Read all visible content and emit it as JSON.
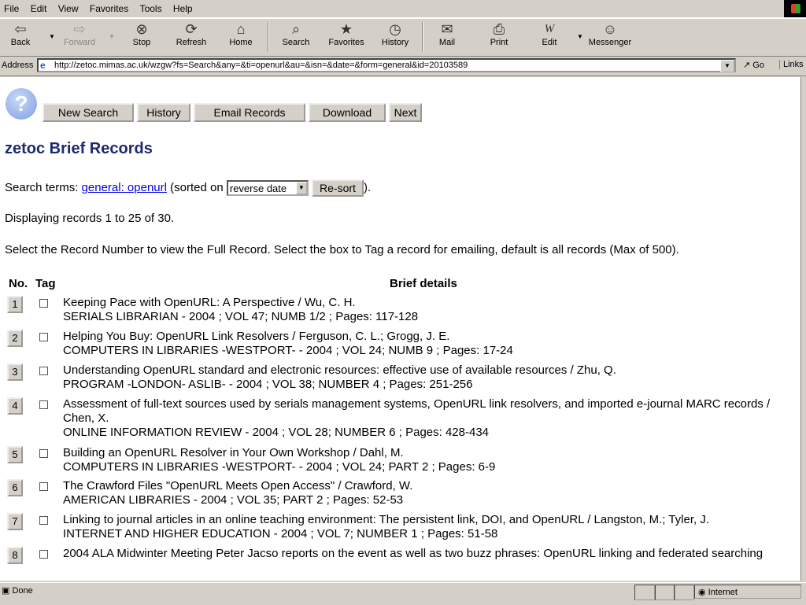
{
  "menu": [
    "File",
    "Edit",
    "View",
    "Favorites",
    "Tools",
    "Help"
  ],
  "toolbar": {
    "back": "Back",
    "forward": "Forward",
    "stop": "Stop",
    "refresh": "Refresh",
    "home": "Home",
    "search": "Search",
    "favorites": "Favorites",
    "history": "History",
    "mail": "Mail",
    "print": "Print",
    "edit": "Edit",
    "messenger": "Messenger"
  },
  "address": {
    "label": "Address",
    "url": "http://zetoc.mimas.ac.uk/wzgw?fs=Search&any=&ti=openurl&au=&isn=&date=&form=general&id=20103589",
    "go": "Go",
    "links": "Links"
  },
  "nav_buttons": [
    "New Search",
    "History",
    "Email Records",
    "Download",
    "Next"
  ],
  "page_title": "zetoc Brief Records",
  "search": {
    "prefix": "Search terms:",
    "link": "general: openurl",
    "sorted_on": "(sorted on",
    "sort_value": "reverse date",
    "resort": "Re-sort",
    "suffix": ")."
  },
  "displaying": "Displaying records 1 to 25 of 30.",
  "instructions": "Select the Record Number to view the Full Record. Select the box to Tag a record for emailing, default is all records (Max of 500).",
  "table_headers": {
    "no": "No.",
    "tag": "Tag",
    "details": "Brief details"
  },
  "records": [
    {
      "no": "1",
      "title": "Keeping Pace with OpenURL: A Perspective / Wu, C. H.",
      "source": "SERIALS LIBRARIAN - 2004 ; VOL 47; NUMB 1/2 ; Pages: 117-128"
    },
    {
      "no": "2",
      "title": "Helping You Buy: OpenURL Link Resolvers / Ferguson, C. L.; Grogg, J. E.",
      "source": "COMPUTERS IN LIBRARIES -WESTPORT- - 2004 ; VOL 24; NUMB 9 ; Pages: 17-24"
    },
    {
      "no": "3",
      "title": "Understanding OpenURL standard and electronic resources: effective use of available resources / Zhu, Q.",
      "source": "PROGRAM -LONDON- ASLIB- - 2004 ; VOL 38; NUMBER 4 ; Pages: 251-256"
    },
    {
      "no": "4",
      "title": "Assessment of full-text sources used by serials management systems, OpenURL link resolvers, and imported e-journal MARC records / Chen, X.",
      "source": "ONLINE INFORMATION REVIEW - 2004 ; VOL 28; NUMBER 6 ; Pages: 428-434"
    },
    {
      "no": "5",
      "title": "Building an OpenURL Resolver in Your Own Workshop / Dahl, M.",
      "source": "COMPUTERS IN LIBRARIES -WESTPORT- - 2004 ; VOL 24; PART 2 ; Pages: 6-9"
    },
    {
      "no": "6",
      "title": "The Crawford Files \"OpenURL Meets Open Access\" / Crawford, W.",
      "source": "AMERICAN LIBRARIES - 2004 ; VOL 35; PART 2 ; Pages: 52-53"
    },
    {
      "no": "7",
      "title": "Linking to journal articles in an online teaching environment: The persistent link, DOI, and OpenURL / Langston, M.; Tyler, J.",
      "source": "INTERNET AND HIGHER EDUCATION - 2004 ; VOL 7; NUMBER 1 ; Pages: 51-58"
    },
    {
      "no": "8",
      "title": "2004 ALA Midwinter Meeting Peter Jacso reports on the event as well as two buzz phrases: OpenURL linking and federated searching",
      "source": ""
    }
  ],
  "status": {
    "text": "Done",
    "zone": "Internet"
  }
}
